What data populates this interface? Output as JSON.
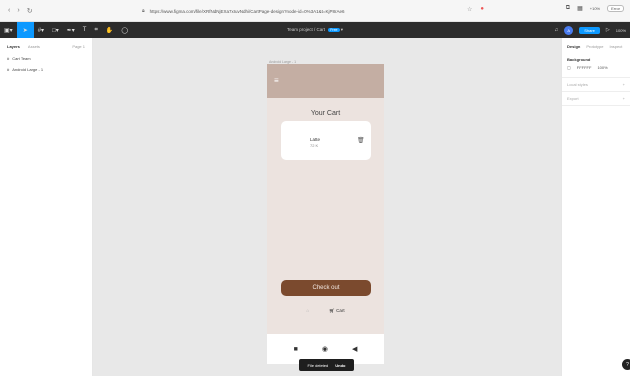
{
  "browser": {
    "back_icon": "arrow-left-icon",
    "forward_icon": "arrow-right-icon",
    "reload_icon": "reload-icon",
    "url": "https://www.figma.com/file/XRfNdNjEXa7xIuvNdhi/CartPage-design?node-id=0%3A1&t=KjP8rAe6",
    "zoom": "+10%",
    "incognito": "Error"
  },
  "toolbar": {
    "project": "Team project",
    "separator": "/",
    "file": "Cart",
    "badge": "Free",
    "share": "Share",
    "zoom": "100%"
  },
  "left_panel": {
    "tabs": [
      "Layers",
      "Assets"
    ],
    "page": "Page 1",
    "layers": [
      {
        "icon": "frame-icon",
        "label": "Cart Team"
      },
      {
        "icon": "frame-icon",
        "label": "Android Large - 1"
      }
    ]
  },
  "canvas": {
    "frame_label": "Android Large - 1",
    "cart_title": "Your Cart",
    "item_name": "Latte",
    "item_price": "72 K",
    "checkout": "Check out",
    "nav_items": [
      {
        "icon": "home-icon",
        "label": ""
      },
      {
        "icon": "cart-icon",
        "label": "Cart"
      }
    ],
    "toast_text": "File deleted",
    "toast_action": "Undo"
  },
  "right_panel": {
    "tabs": [
      "Design",
      "Prototype",
      "Inspect"
    ],
    "background_label": "Background",
    "bg_hex": "FFFFFF",
    "bg_opacity": "100%",
    "local_styles": "Local styles",
    "export": "Export"
  },
  "colors": {
    "accent": "#0d99ff",
    "phone_bg": "#ece3df",
    "header": "#c4aea3",
    "checkout": "#7b4a2e"
  }
}
